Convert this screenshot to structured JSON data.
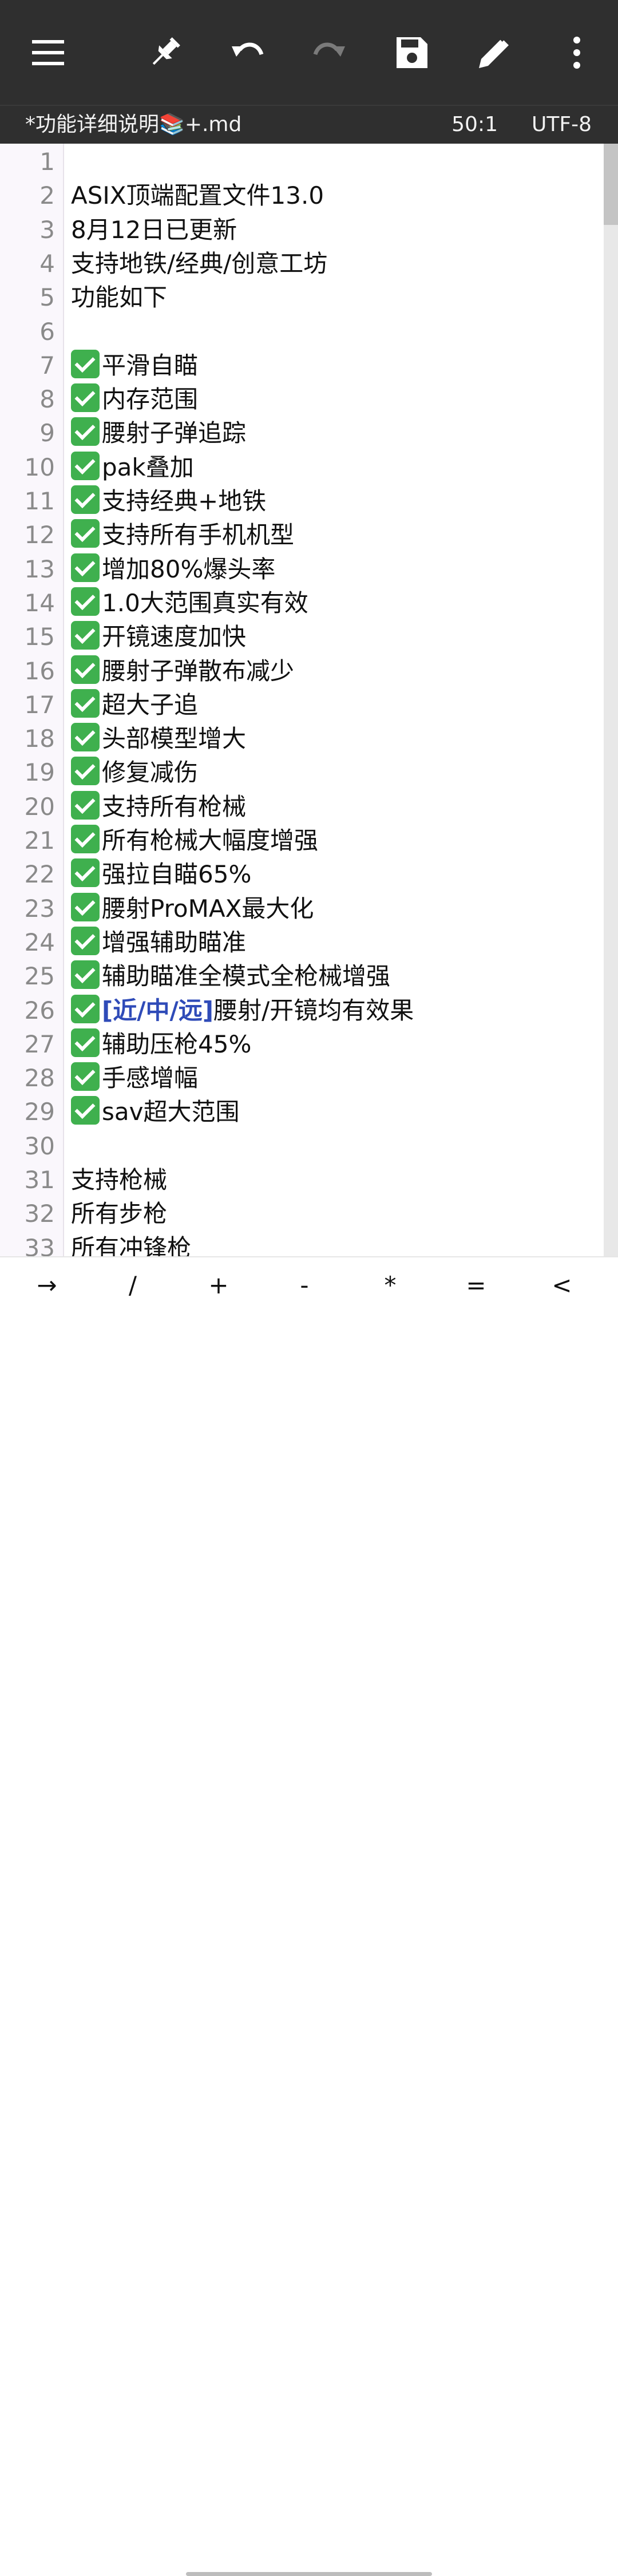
{
  "toolbar": {
    "icons": [
      "menu-icon",
      "pin-icon",
      "undo-icon",
      "redo-icon",
      "save-icon",
      "edit-icon",
      "more-icon"
    ]
  },
  "status": {
    "filename": "*功能详细说明📚+.md",
    "position": "50:1",
    "encoding": "UTF-8"
  },
  "editor": {
    "lines": [
      {
        "num": "1",
        "text": ""
      },
      {
        "num": "2",
        "text": "ASIX顶端配置文件13.0"
      },
      {
        "num": "3",
        "text": "8月12日已更新"
      },
      {
        "num": "4",
        "text": "支持地铁/经典/创意工坊"
      },
      {
        "num": "5",
        "text": "功能如下"
      },
      {
        "num": "6",
        "text": ""
      },
      {
        "num": "7",
        "check": true,
        "text": "平滑自瞄"
      },
      {
        "num": "8",
        "check": true,
        "text": "内存范围"
      },
      {
        "num": "9",
        "check": true,
        "text": "腰射子弹追踪"
      },
      {
        "num": "10",
        "check": true,
        "text": "pak叠加"
      },
      {
        "num": "11",
        "check": true,
        "text": "支持经典+地铁"
      },
      {
        "num": "12",
        "check": true,
        "text": "支持所有手机机型"
      },
      {
        "num": "13",
        "check": true,
        "text": "增加80%爆头率"
      },
      {
        "num": "14",
        "check": true,
        "text": "1.0大范围真实有效"
      },
      {
        "num": "15",
        "check": true,
        "text": "开镜速度加快"
      },
      {
        "num": "16",
        "check": true,
        "text": "腰射子弹散布减少"
      },
      {
        "num": "17",
        "check": true,
        "text": "超大子追"
      },
      {
        "num": "18",
        "check": true,
        "text": "头部模型增大"
      },
      {
        "num": "19",
        "check": true,
        "text": "修复减伤"
      },
      {
        "num": "20",
        "check": true,
        "text": "支持所有枪械"
      },
      {
        "num": "21",
        "check": true,
        "text": "所有枪械大幅度增强"
      },
      {
        "num": "22",
        "check": true,
        "text": "强拉自瞄65%"
      },
      {
        "num": "23",
        "check": true,
        "text": "腰射ProMAX最大化"
      },
      {
        "num": "24",
        "check": true,
        "text": "增强辅助瞄准"
      },
      {
        "num": "25",
        "check": true,
        "text": "辅助瞄准全模式全枪械增强"
      },
      {
        "num": "26",
        "check": true,
        "highlight": "[近/中/远]",
        "text": "腰射/开镜均有效果"
      },
      {
        "num": "27",
        "check": true,
        "text": "辅助压枪45%"
      },
      {
        "num": "28",
        "check": true,
        "text": "手感增幅"
      },
      {
        "num": "29",
        "check": true,
        "text": "sav超大范围"
      },
      {
        "num": "30",
        "text": ""
      },
      {
        "num": "31",
        "text": "支持枪械"
      },
      {
        "num": "32",
        "text": "所有步枪"
      },
      {
        "num": "33",
        "text": "所有冲锋枪"
      }
    ]
  },
  "keys": [
    "→",
    "/",
    "+",
    "-",
    "*",
    "=",
    "<"
  ],
  "colors": {
    "bar": "#2f2f2f",
    "check": "#3fb04e",
    "highlight": "#2f4bb8",
    "redo_disabled": "#7a7a7a"
  }
}
